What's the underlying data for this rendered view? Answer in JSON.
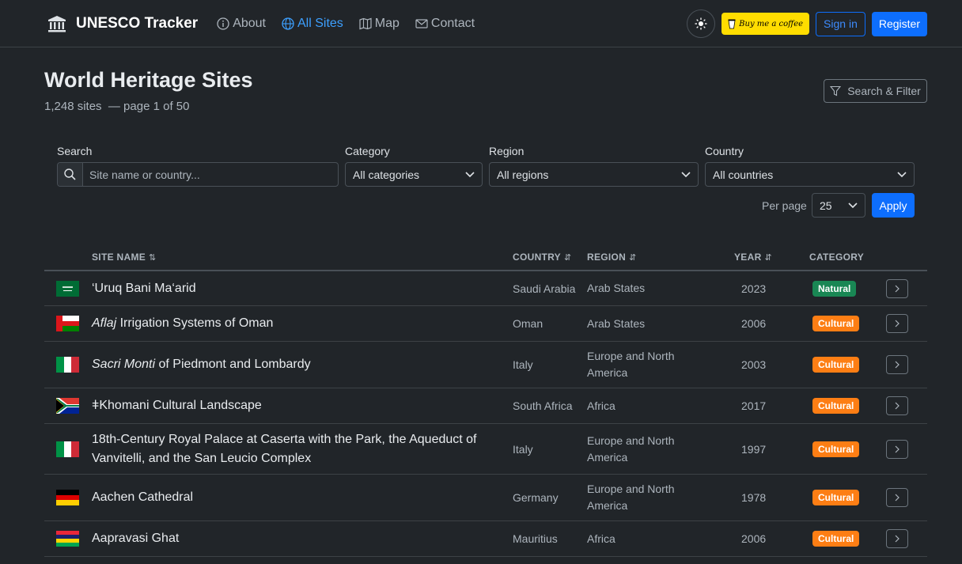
{
  "nav": {
    "brand": "UNESCO Tracker",
    "links": [
      {
        "label": "About",
        "icon": "info-icon"
      },
      {
        "label": "All Sites",
        "icon": "globe-icon",
        "active": true
      },
      {
        "label": "Map",
        "icon": "map-icon"
      },
      {
        "label": "Contact",
        "icon": "envelope-icon"
      }
    ],
    "coffee_label": "Buy me a coffee",
    "signin_label": "Sign in",
    "register_label": "Register"
  },
  "header": {
    "title": "World Heritage Sites",
    "subtitle": "1,248 sites  — page 1 of 50",
    "filter_button": "Search & Filter"
  },
  "filters": {
    "search_label": "Search",
    "search_placeholder": "Site name or country...",
    "category_label": "Category",
    "category_value": "All categories",
    "region_label": "Region",
    "region_value": "All regions",
    "country_label": "Country",
    "country_value": "All countries",
    "per_page_label": "Per page",
    "per_page_value": "25",
    "apply_label": "Apply"
  },
  "table": {
    "headers": {
      "site": "SITE NAME",
      "country": "COUNTRY",
      "region": "REGION",
      "year": "YEAR",
      "category": "CATEGORY"
    },
    "rows": [
      {
        "flag": "saudi-arabia",
        "name": "‘Uruq Bani Ma‘arid",
        "country": "Saudi Arabia",
        "region": "Arab States",
        "year": "2023",
        "category": "Natural"
      },
      {
        "flag": "oman",
        "name_em": "Aflaj",
        "name": " Irrigation Systems of Oman",
        "country": "Oman",
        "region": "Arab States",
        "year": "2006",
        "category": "Cultural"
      },
      {
        "flag": "italy",
        "name_em": "Sacri Monti",
        "name": " of Piedmont and Lombardy",
        "country": "Italy",
        "region": "Europe and North America",
        "year": "2003",
        "category": "Cultural"
      },
      {
        "flag": "south-africa",
        "name": "ǂKhomani Cultural Landscape",
        "country": "South Africa",
        "region": "Africa",
        "year": "2017",
        "category": "Cultural"
      },
      {
        "flag": "italy",
        "name": "18th-Century Royal Palace at Caserta with the Park, the Aqueduct of Vanvitelli, and the San Leucio Complex",
        "country": "Italy",
        "region": "Europe and North America",
        "year": "1997",
        "category": "Cultural"
      },
      {
        "flag": "germany",
        "name": "Aachen Cathedral",
        "country": "Germany",
        "region": "Europe and North America",
        "year": "1978",
        "category": "Cultural"
      },
      {
        "flag": "mauritius",
        "name": "Aapravasi Ghat",
        "country": "Mauritius",
        "region": "Africa",
        "year": "2006",
        "category": "Cultural"
      }
    ]
  }
}
